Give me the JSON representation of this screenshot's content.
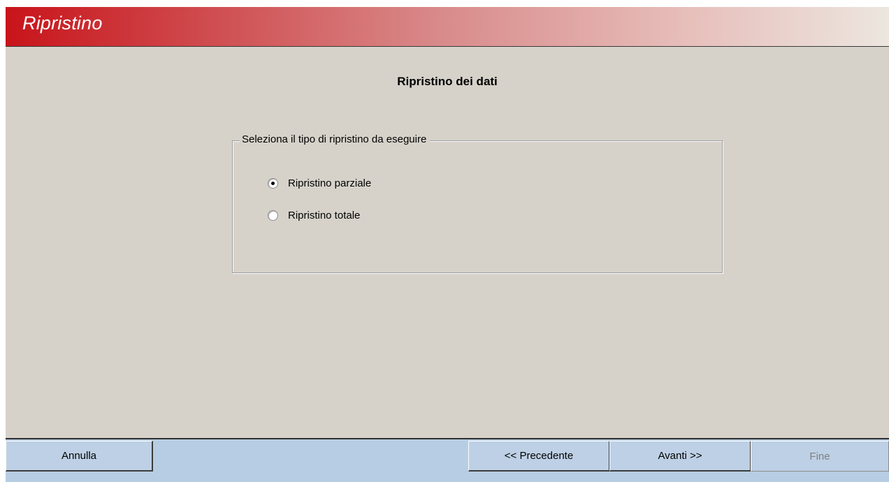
{
  "window": {
    "title": "Ripristino"
  },
  "main": {
    "heading": "Ripristino dei dati",
    "group": {
      "legend": "Seleziona il tipo di ripristino da eseguire",
      "options": [
        {
          "label": "Ripristino parziale",
          "selected": true
        },
        {
          "label": "Ripristino totale",
          "selected": false
        }
      ]
    }
  },
  "footer": {
    "cancel_label": "Annulla",
    "back_label": "<< Precedente",
    "next_label": "Avanti >>",
    "finish_label": "Fine"
  },
  "colors": {
    "title_red": "#c8141a",
    "panel_bg": "#d6d2ca",
    "footer_bg": "#b7cde3"
  }
}
